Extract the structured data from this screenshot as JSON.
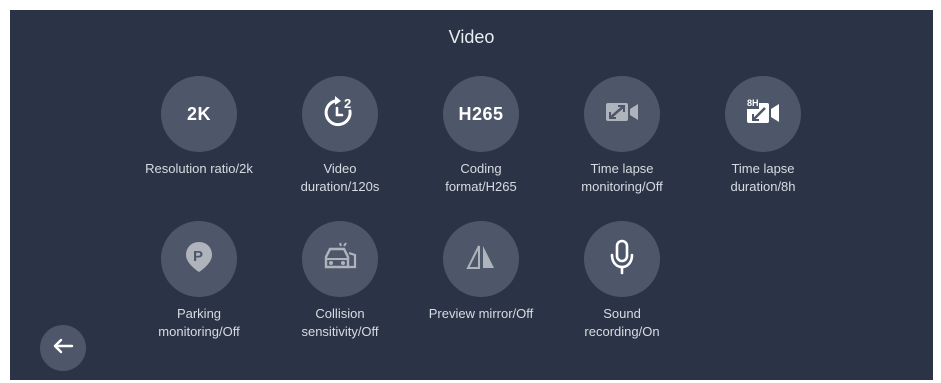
{
  "page": {
    "title": "Video"
  },
  "tiles": [
    {
      "icon_text": "2K",
      "label_line1": "Resolution ratio/2k",
      "label_line2": ""
    },
    {
      "icon": "timer-2-icon",
      "label_line1": "Video",
      "label_line2": "duration/120s"
    },
    {
      "icon_text": "H265",
      "label_line1": "Coding",
      "label_line2": "format/H265"
    },
    {
      "icon": "timelapse-camera-icon",
      "label_line1": "Time lapse",
      "label_line2": "monitoring/Off"
    },
    {
      "icon": "timelapse-8h-camera-icon",
      "icon_badge": "8H",
      "label_line1": "Time lapse",
      "label_line2": "duration/8h"
    },
    {
      "icon": "parking-pin-icon",
      "label_line1": "Parking",
      "label_line2": "monitoring/Off"
    },
    {
      "icon": "car-collision-icon",
      "label_line1": "Collision",
      "label_line2": "sensitivity/Off"
    },
    {
      "icon": "mirror-triangle-icon",
      "label_line1": "Preview mirror/Off",
      "label_line2": ""
    },
    {
      "icon": "microphone-icon",
      "label_line1": "Sound",
      "label_line2": "recording/On"
    }
  ],
  "nav": {
    "back_icon": "back-arrow-icon"
  },
  "colors": {
    "background": "#2b3446",
    "tile": "#4e5769",
    "text": "#e9ecf1"
  }
}
